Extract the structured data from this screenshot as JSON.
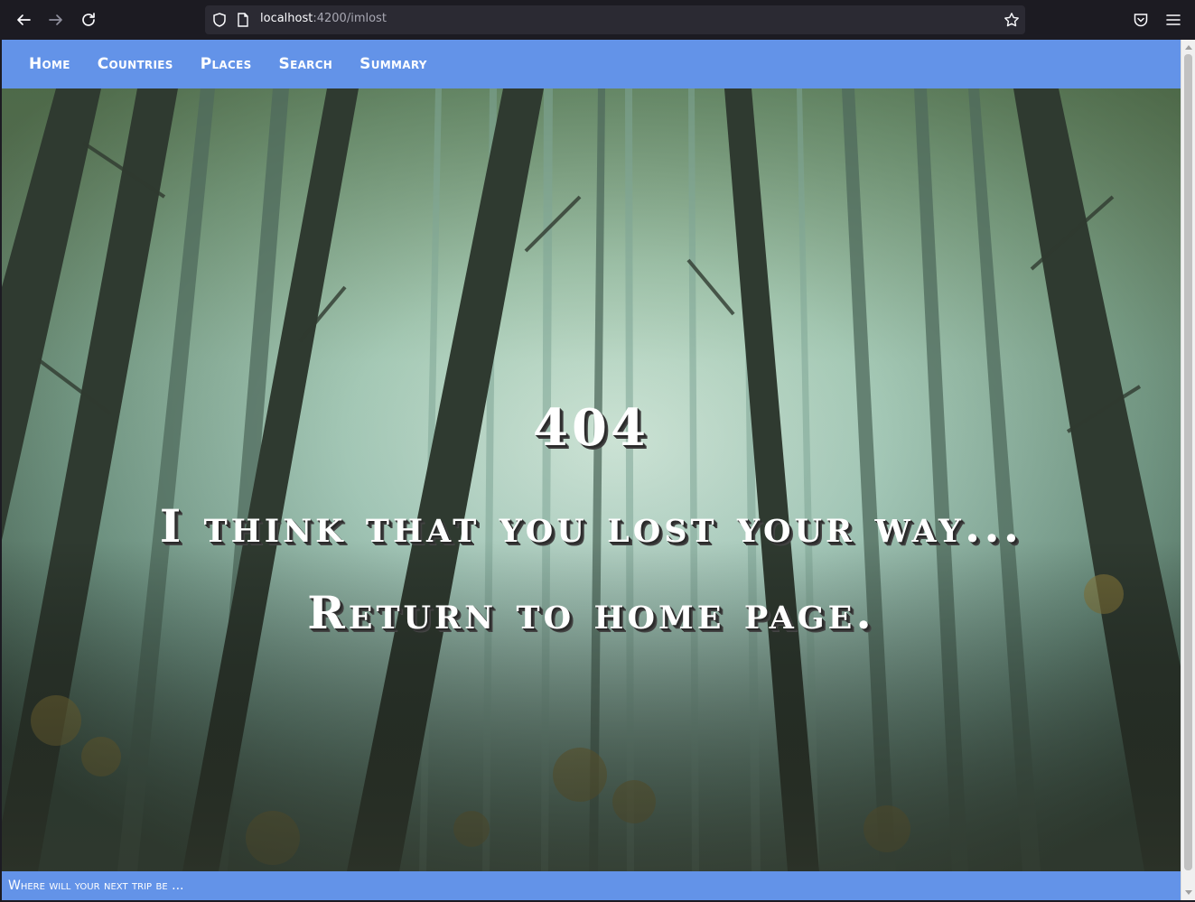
{
  "browser": {
    "url_host": "localhost",
    "url_rest": ":4200/imlost",
    "icons": [
      "back-arrow-icon",
      "forward-arrow-icon",
      "reload-icon",
      "shield-icon",
      "page-icon",
      "star-icon",
      "pocket-icon",
      "hamburger-menu-icon"
    ]
  },
  "nav": {
    "items": [
      {
        "label": "Home"
      },
      {
        "label": "Countries"
      },
      {
        "label": "Places"
      },
      {
        "label": "Search"
      },
      {
        "label": "Summary"
      }
    ]
  },
  "hero": {
    "code": "404",
    "message": "I think that you lost your way...",
    "return_link": "Return to home page."
  },
  "footer": {
    "text": "Where will your next trip be ..."
  },
  "colors": {
    "accent": "#6393e8",
    "chrome": "#1c1b22",
    "urlbar": "#2b2a33",
    "forest_light": "#bfe0d6",
    "forest_dark": "#2f3d33"
  }
}
